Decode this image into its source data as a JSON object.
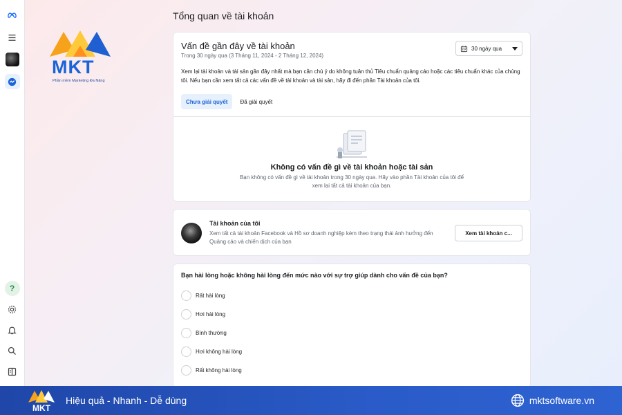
{
  "page": {
    "title": "Tổng quan về tài khoản"
  },
  "issues_card": {
    "title": "Vấn đề gần đây về tài khoản",
    "range": "Trong 30 ngày qua (3 Tháng 11, 2024 - 2 Tháng 12, 2024)",
    "date_filter": "30 ngày qua",
    "description": "Xem lại tài khoản và tài sản gần đây nhất mà bạn cần chú ý do không tuân thủ Tiêu chuẩn quảng cáo hoặc các tiêu chuẩn khác của chúng tôi. Nếu bạn cần xem tất cả các vấn đề về tài khoản và tài sản, hãy đi đến phần Tài khoản của tôi.",
    "tabs": [
      {
        "label": "Chưa giải quyết"
      },
      {
        "label": "Đã giải quyết"
      }
    ],
    "empty_title": "Không có vấn đề gì về tài khoản hoặc tài sản",
    "empty_desc": "Bạn không có vấn đề gì về tài khoản trong 30 ngày qua. Hãy vào phần Tài khoản của tôi để xem lại tất cả tài khoản của bạn."
  },
  "account_card": {
    "title": "Tài khoản của tôi",
    "description": "Xem tất cả tài khoản Facebook và Hồ sơ doanh nghiệp kèm theo trạng thái ảnh hưởng đến Quảng cáo và chiến dịch của bạn",
    "button": "Xem tài khoản c..."
  },
  "survey_card": {
    "question": "Bạn hài lòng hoặc không hài lòng đến mức nào với sự trợ giúp dành cho vấn đề của bạn?",
    "options": [
      {
        "label": "Rất hài lòng"
      },
      {
        "label": "Hơi hài lòng"
      },
      {
        "label": "Bình thường"
      },
      {
        "label": "Hơi không hài lòng"
      },
      {
        "label": "Rất không hài lòng"
      }
    ]
  },
  "logo": {
    "text": "MKT",
    "subtitle": "Phần mềm Marketing Đa Năng"
  },
  "banner": {
    "slogan": "Hiệu quả - Nhanh - Dễ dùng",
    "website": "mktsoftware.vn"
  },
  "colors": {
    "accent": "#1a64d8",
    "banner": "#2a5bc8",
    "logo_orange": "#f7a21b"
  },
  "icons": [
    "meta-icon",
    "menu-icon",
    "help-icon",
    "settings-icon",
    "bell-icon",
    "search-icon",
    "panel-icon",
    "calendar-icon",
    "globe-icon"
  ]
}
